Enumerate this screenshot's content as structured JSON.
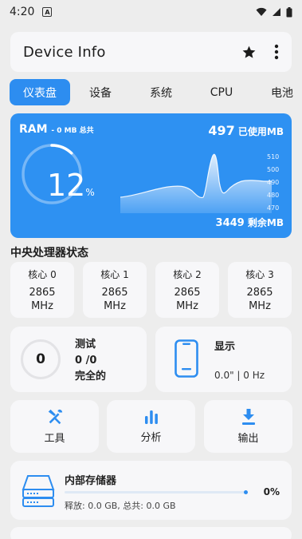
{
  "status_bar": {
    "time": "4:20",
    "notification_icon": "A"
  },
  "app_bar": {
    "title": "Device Info"
  },
  "tabs": [
    "仪表盘",
    "设备",
    "系统",
    "CPU",
    "电池"
  ],
  "ram": {
    "label": "RAM",
    "total": "- 0 MB 总共",
    "used_value": "497",
    "used_label": "已使用MB",
    "percent": "12",
    "percent_unit": "%",
    "percent_value": 0.12,
    "remaining_value": "3449",
    "remaining_label": "剩余MB",
    "accent_color": "#2e91f2"
  },
  "chart_data": {
    "type": "area",
    "y_ticks": [
      "510",
      "500",
      "490",
      "480",
      "470"
    ],
    "ylim": [
      467,
      512
    ]
  },
  "cpu_section": {
    "title": "中央处理器状态",
    "cores": [
      {
        "name": "核心 0",
        "freq": "2865",
        "unit": "MHz"
      },
      {
        "name": "核心 1",
        "freq": "2865",
        "unit": "MHz"
      },
      {
        "name": "核心 2",
        "freq": "2865",
        "unit": "MHz"
      },
      {
        "name": "核心 3",
        "freq": "2865",
        "unit": "MHz"
      }
    ]
  },
  "test_card": {
    "count": "0",
    "title": "测试",
    "progress": "0 /0",
    "status": "完全的"
  },
  "display_card": {
    "title": "显示",
    "value": "0.0\" | 0 Hz"
  },
  "actions": {
    "tools": "工具",
    "analyze": "分析",
    "export": "输出"
  },
  "storage": {
    "title": "内部存储器",
    "free_total": "释放: 0.0 GB, 总共: 0.0 GB",
    "percent": "0%"
  }
}
